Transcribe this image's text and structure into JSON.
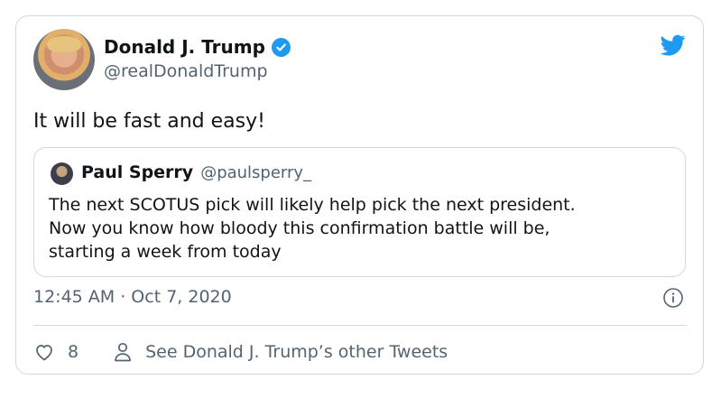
{
  "author": {
    "display_name": "Donald J. Trump",
    "handle": "@realDonaldTrump",
    "verified": true
  },
  "tweet": {
    "text": "It will be fast and easy!",
    "timestamp": "12:45 AM · Oct 7, 2020",
    "like_count": "8",
    "see_more_label": "See Donald J. Trump’s other Tweets"
  },
  "quoted": {
    "display_name": "Paul Sperry",
    "handle": "@paulsperry_",
    "lines": [
      "The next SCOTUS pick will likely help pick the next president.",
      "Now you know how bloody this confirmation battle will be,",
      "starting a week from today"
    ]
  },
  "icons": {
    "brand": "twitter-bird-icon",
    "verified": "verified-badge-icon",
    "info": "info-icon",
    "like": "heart-icon",
    "profile": "person-icon"
  },
  "colors": {
    "accent": "#1d9bf0",
    "secondary_text": "#536471",
    "border": "#cfd9de",
    "text": "#0f1419"
  }
}
